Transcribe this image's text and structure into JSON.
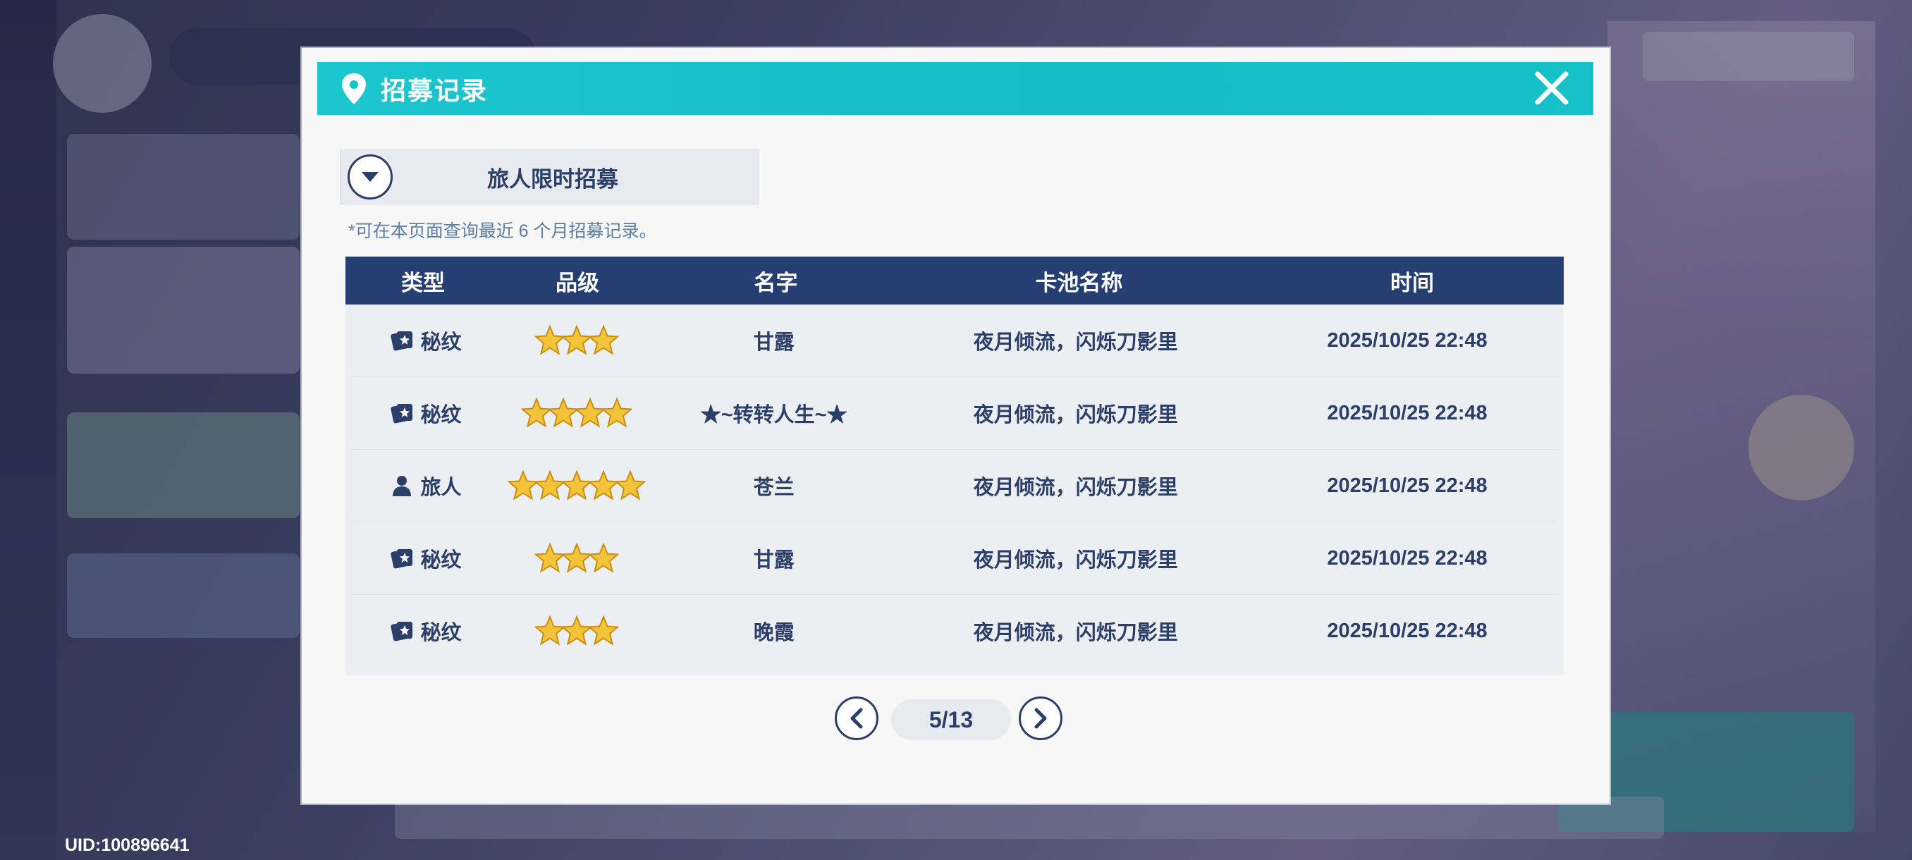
{
  "dialog": {
    "title": "招募记录",
    "pool_name": "旅人限时招募",
    "note": "*可在本页面查询最近 6 个月招募记录。"
  },
  "table": {
    "headers": [
      "类型",
      "品级",
      "名字",
      "卡池名称",
      "时间"
    ],
    "rows": [
      {
        "type": "秘纹",
        "type_icon": "card-icon",
        "stars": 3,
        "name": "甘露",
        "pool": "夜月倾流，闪烁刀影里",
        "time": "2025/10/25 22:48"
      },
      {
        "type": "秘纹",
        "type_icon": "card-icon",
        "stars": 4,
        "name": "★~转转人生~★",
        "pool": "夜月倾流，闪烁刀影里",
        "time": "2025/10/25 22:48"
      },
      {
        "type": "旅人",
        "type_icon": "person-icon",
        "stars": 5,
        "name": "苍兰",
        "pool": "夜月倾流，闪烁刀影里",
        "time": "2025/10/25 22:48"
      },
      {
        "type": "秘纹",
        "type_icon": "card-icon",
        "stars": 3,
        "name": "甘露",
        "pool": "夜月倾流，闪烁刀影里",
        "time": "2025/10/25 22:48"
      },
      {
        "type": "秘纹",
        "type_icon": "card-icon",
        "stars": 3,
        "name": "晚霞",
        "pool": "夜月倾流，闪烁刀影里",
        "time": "2025/10/25 22:48"
      }
    ]
  },
  "pagination": {
    "current": "5/13"
  },
  "footer": {
    "uid": "UID:100896641"
  },
  "colors": {
    "header_bar": "#14bcc4",
    "table_header": "#263f72",
    "text_primary": "#2c3f68",
    "star": "#f3c33a"
  }
}
